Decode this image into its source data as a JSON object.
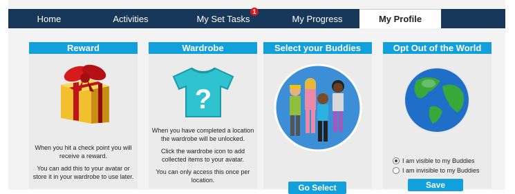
{
  "nav": {
    "tabs": [
      {
        "label": "Home"
      },
      {
        "label": "Activities"
      },
      {
        "label": "My Set Tasks",
        "badge": "1"
      },
      {
        "label": "My Progress"
      },
      {
        "label": "My Profile",
        "active": true
      }
    ]
  },
  "cards": {
    "reward": {
      "title": "Reward",
      "text1": "When you hit a check point you will receive a reward.",
      "text2": "You can add this to your avatar or store it in your wardrobe to use later.",
      "icon": "gift-icon"
    },
    "wardrobe": {
      "title": "Wardrobe",
      "text1": "When you have completed a location the wardrobe will be unlocked.",
      "text2": "Click the wardrobe icon to add collected items to your avatar.",
      "text3": "You can only access this once per location.",
      "icon": "tshirt-question-icon"
    },
    "buddies": {
      "title": "Select your Buddies",
      "button": "Go Select",
      "icon": "buddies-group-icon"
    },
    "optout": {
      "title": "Opt Out of the World",
      "option_visible": "I am visible to my Buddies",
      "option_invisible": "I am invisible to my Buddies",
      "selected": "visible",
      "button": "Save",
      "icon": "globe-icon"
    }
  },
  "colors": {
    "nav_bg": "#17385a",
    "accent": "#12a0dd",
    "badge": "#d61b1b"
  }
}
